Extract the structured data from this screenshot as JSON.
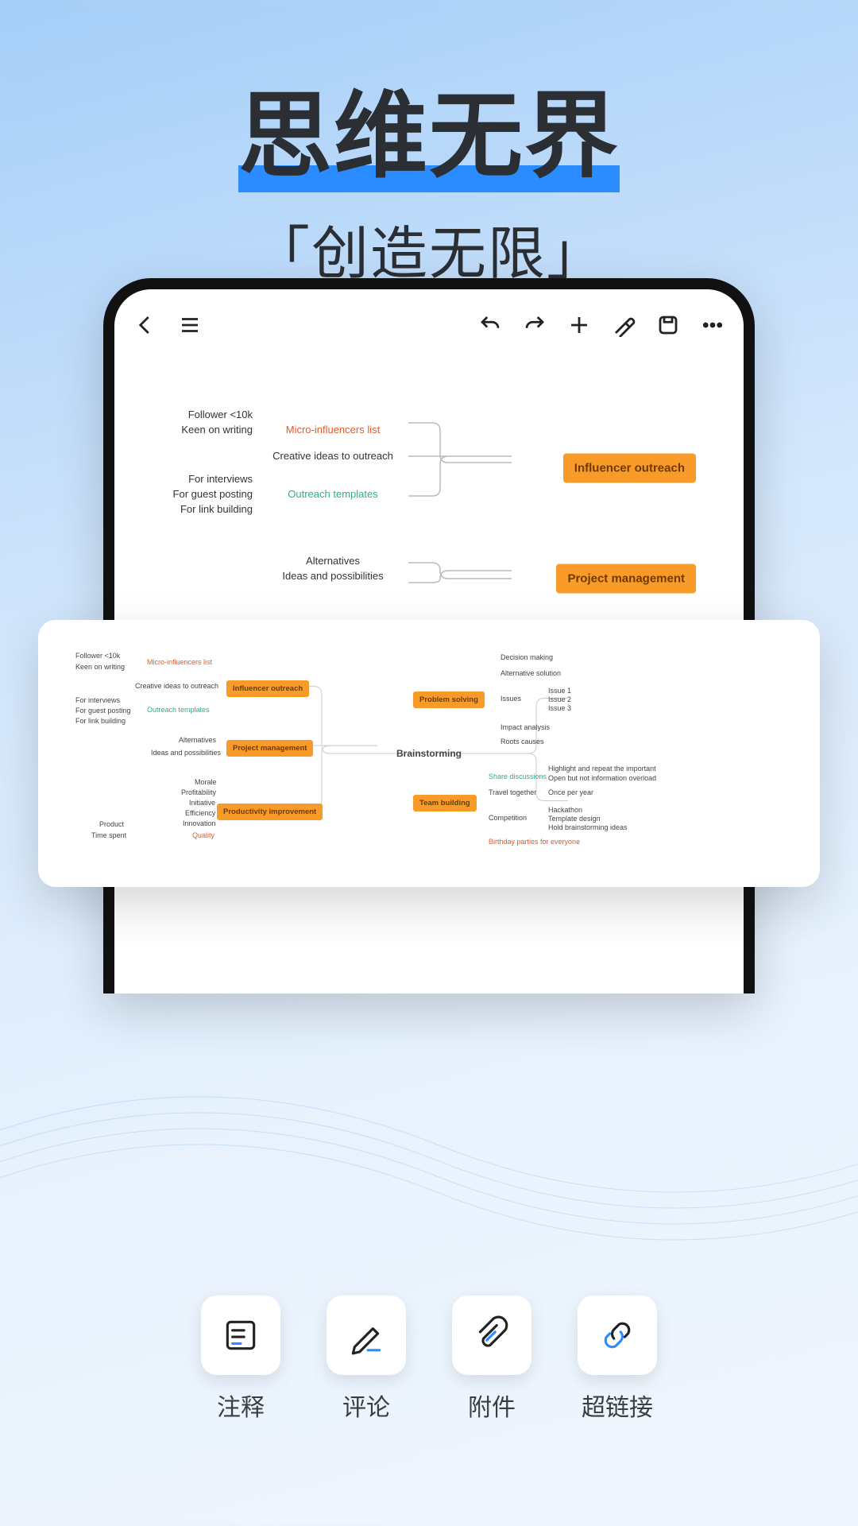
{
  "headline": {
    "title": "思维无界",
    "subtitle": "「创造无限」"
  },
  "toolbar_icons": [
    "back",
    "menu",
    "undo",
    "redo",
    "add",
    "style",
    "save",
    "more"
  ],
  "mindmap_phone": {
    "groups": [
      {
        "box": "Influencer outreach",
        "mids": [
          {
            "label": "Micro-influencers list",
            "cls": "red",
            "leaves": [
              "Follower <10k",
              "Keen on writing"
            ]
          },
          {
            "label": "Creative ideas to outreach",
            "cls": "",
            "leaves": []
          },
          {
            "label": "Outreach templates",
            "cls": "grn",
            "leaves": [
              "For interviews",
              "For guest posting",
              "For link building"
            ]
          }
        ]
      },
      {
        "box": "Project management",
        "mids": [
          {
            "label": "Alternatives",
            "cls": "",
            "leaves": []
          },
          {
            "label": "Ideas and possibilities",
            "cls": "",
            "leaves": []
          }
        ]
      },
      {
        "box": "",
        "mids": [
          {
            "label": "Morale",
            "cls": "",
            "leaves": []
          }
        ]
      }
    ]
  },
  "mindmap_full": {
    "center": "Brainstorming",
    "left_boxes": [
      "Influencer outreach",
      "Project management",
      "Productivity improvement"
    ],
    "right_boxes": [
      "Problem solving",
      "Team building"
    ],
    "left_mids": {
      "micro": "Micro-influencers list",
      "creative": "Creative ideas to outreach",
      "templates": "Outreach templates",
      "alternatives": "Alternatives",
      "ideas": "Ideas and possibilities",
      "morale": "Morale",
      "profit": "Profitability",
      "initiative": "Initiative",
      "eff": "Efficiency",
      "innov": "Innovation",
      "quality": "Quality"
    },
    "left_leaves": {
      "fol": "Follower <10k",
      "keen": "Keen on writing",
      "interview": "For interviews",
      "guest": "For guest posting",
      "link": "For link building",
      "product": "Product",
      "time": "Time spent"
    },
    "right_mids": {
      "decision": "Decision making",
      "alt_sol": "Alternative solution",
      "issues": "Issues",
      "impact": "Impact analysis",
      "roots": "Roots causes",
      "share": "Share discussions",
      "travel": "Travel together",
      "comp": "Competition",
      "bday": "Birthday parties for everyone"
    },
    "right_leaves": {
      "i1": "Issue 1",
      "i2": "Issue 2",
      "i3": "Issue 3",
      "hl": "Highlight and repeat the important",
      "open": "Open but not information overload",
      "once": "Once per year",
      "hack": "Hackathon",
      "tmpl": "Template design",
      "hold": "Hold brainstorming ideas"
    }
  },
  "features": [
    {
      "icon": "note",
      "label": "注释"
    },
    {
      "icon": "pencil",
      "label": "评论"
    },
    {
      "icon": "clip",
      "label": "附件"
    },
    {
      "icon": "link",
      "label": "超链接"
    }
  ]
}
